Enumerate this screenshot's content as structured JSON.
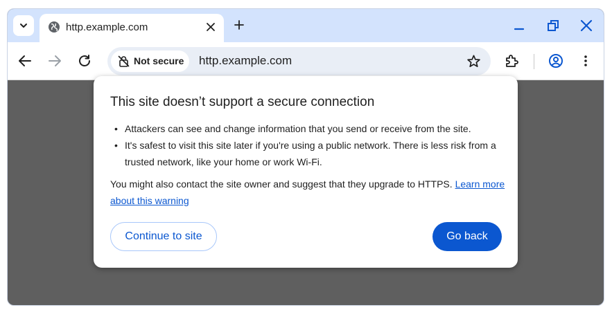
{
  "tab": {
    "title": "http.example.com",
    "favicon": "globe-icon"
  },
  "toolbar": {
    "security_chip": "Not secure",
    "url": "http.example.com"
  },
  "dialog": {
    "title": "This site doesn’t support a secure connection",
    "bullets": [
      "Attackers can see and change information that you send or receive from the site.",
      "It's safest to visit this site later if you're using a public network. There is less risk from a trusted network, like your home or work Wi-Fi."
    ],
    "paragraph": "You might also contact the site owner and suggest that they upgrade to HTTPS.",
    "link": "Learn more about this warning",
    "continue_label": "Continue to site",
    "back_label": "Go back"
  },
  "colors": {
    "tabstrip_bg": "#d3e3fd",
    "accent": "#0b57d0",
    "page_overlay": "#5f5f5f"
  },
  "icons": [
    "chevron-down-icon",
    "globe-icon",
    "close-icon",
    "plus-icon",
    "minimize-icon",
    "restore-icon",
    "back-arrow-icon",
    "forward-arrow-icon",
    "reload-icon",
    "not-secure-icon",
    "star-icon",
    "extensions-icon",
    "profile-icon",
    "more-menu-icon"
  ]
}
